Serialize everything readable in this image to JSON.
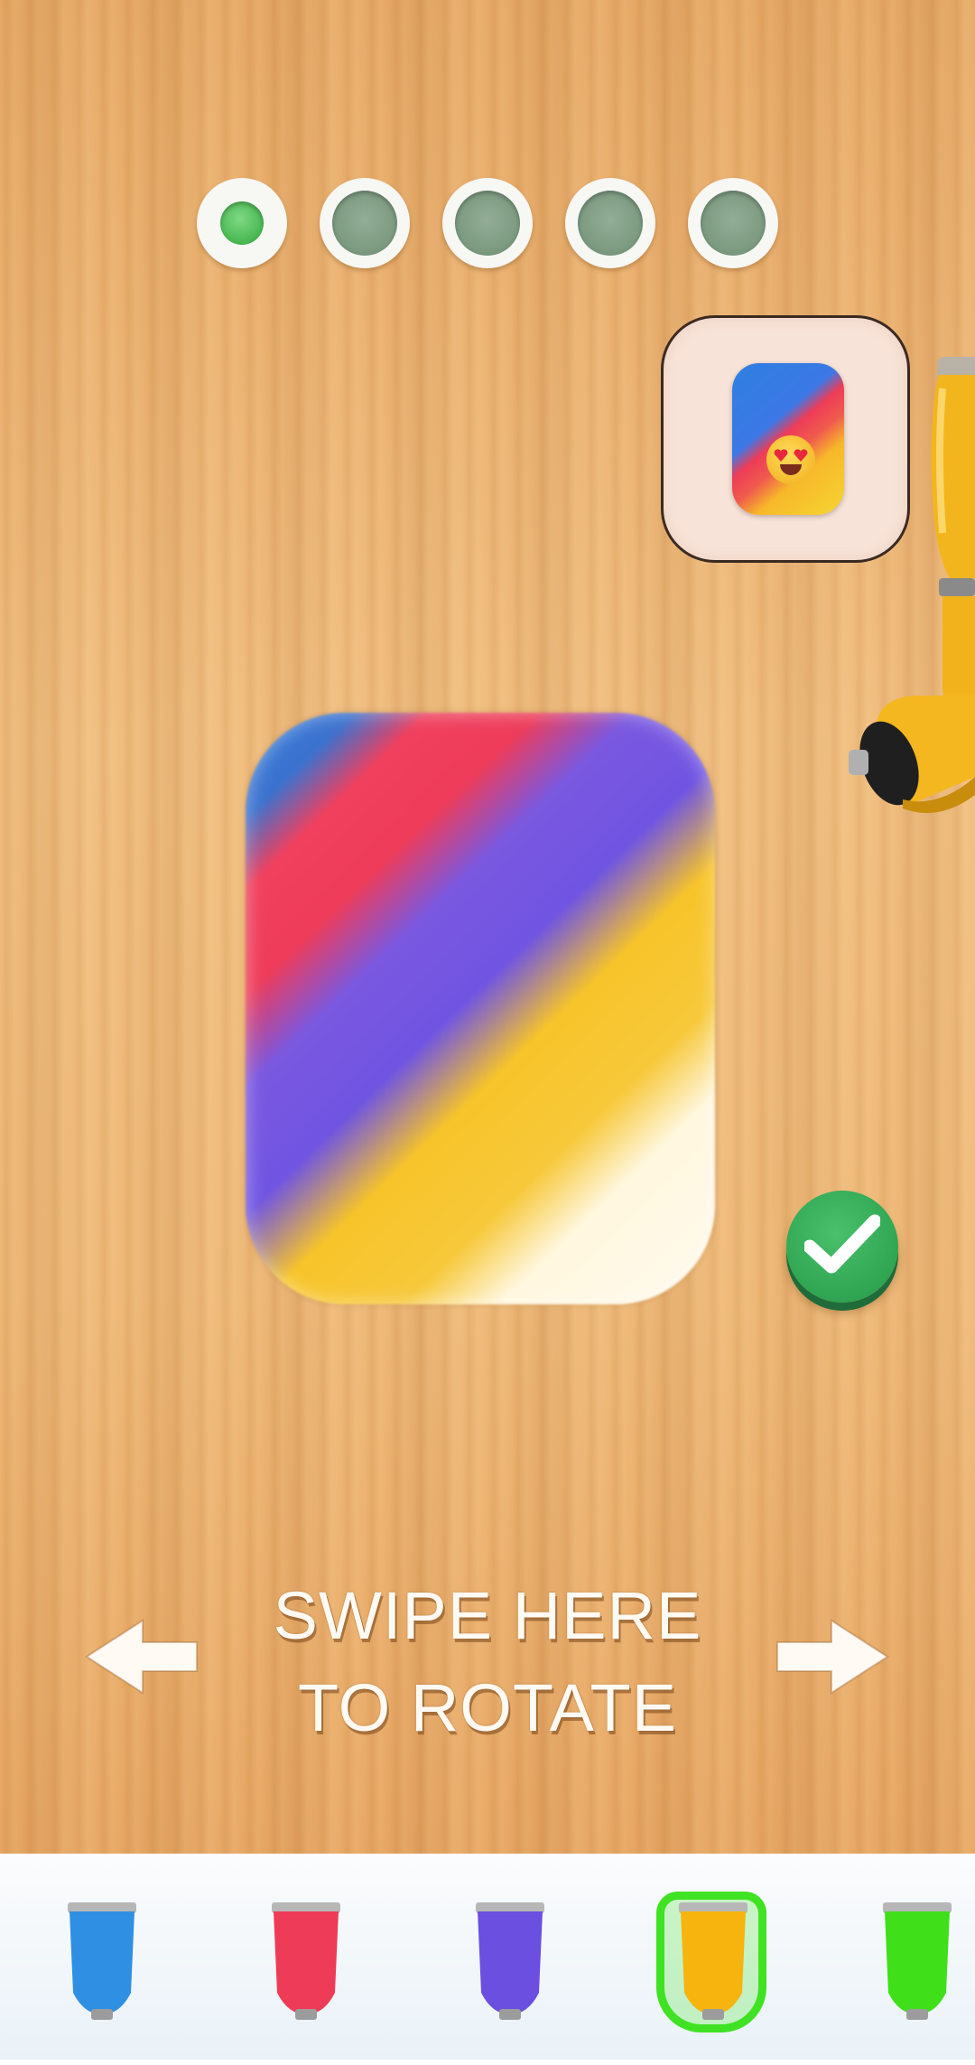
{
  "progress": {
    "dots": [
      {
        "label": "step-1",
        "state": "active"
      },
      {
        "label": "step-2",
        "state": "pending"
      },
      {
        "label": "step-3",
        "state": "pending"
      },
      {
        "label": "step-4",
        "state": "pending"
      },
      {
        "label": "step-5",
        "state": "pending"
      }
    ]
  },
  "target_preview": {
    "icon": "heart-eyes-emoji-icon",
    "colors": [
      "#2f7fe0",
      "#ee3c58",
      "#f7b82a",
      "#f6d633"
    ]
  },
  "canvas": {
    "stripe_colors": [
      "#2e78d6",
      "#ee3c5a",
      "#7055e2",
      "#f7c42a",
      "#fffaf0"
    ]
  },
  "confirm": {
    "icon": "checkmark-icon",
    "color": "#30a552"
  },
  "hint": {
    "line1": "SWIPE HERE",
    "line2": "TO ROTATE",
    "left_icon": "arrow-left-icon",
    "right_icon": "arrow-right-icon"
  },
  "palette": {
    "selected_index": 3,
    "tubes": [
      {
        "name": "blue",
        "color": "#2f8fe3"
      },
      {
        "name": "red",
        "color": "#ee3b57"
      },
      {
        "name": "purple",
        "color": "#6a4fe0"
      },
      {
        "name": "yellow",
        "color": "#f7b40f"
      },
      {
        "name": "green",
        "color": "#3fe01a"
      }
    ]
  }
}
